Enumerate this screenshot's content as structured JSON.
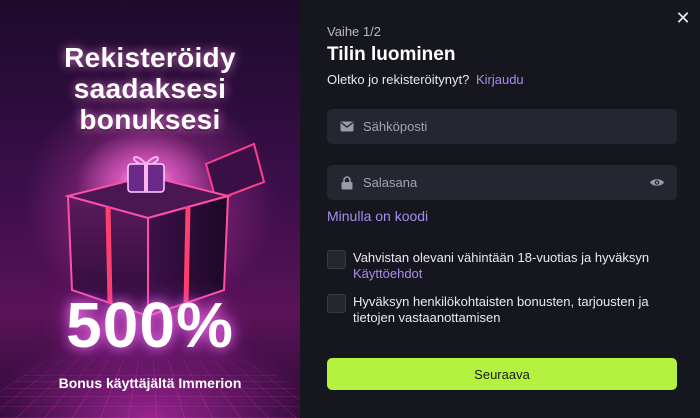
{
  "promo": {
    "title": "Rekisteröidy\nsaadaksesi\nbonuksesi",
    "big_text": "500%",
    "subtitle": "Bonus käyttäjältä Immerion"
  },
  "form": {
    "step": "Vaihe 1/2",
    "heading": "Tilin luominen",
    "already_registered": "Oletko jo rekisteröitynyt?",
    "login_link": "Kirjaudu",
    "email_placeholder": "Sähköposti",
    "password_placeholder": "Salasana",
    "code_link": "Minulla on koodi",
    "age_consent_text": "Vahvistan olevani vähintään 18-vuotias ja hyväksyn",
    "terms_link": "Käyttöehdot",
    "marketing_consent_text": "Hyväksyn henkilökohtaisten bonusten, tarjousten ja tietojen vastaanottamisen",
    "submit_label": "Seuraava",
    "close_symbol": "✕"
  },
  "colors": {
    "accent_link": "#a98cf0",
    "submit_bg": "#b4f23f",
    "panel_bg": "#16161e",
    "field_bg": "#262630"
  },
  "icons": [
    "close-icon",
    "mail-icon",
    "lock-icon",
    "eye-icon",
    "gift-box-image"
  ]
}
